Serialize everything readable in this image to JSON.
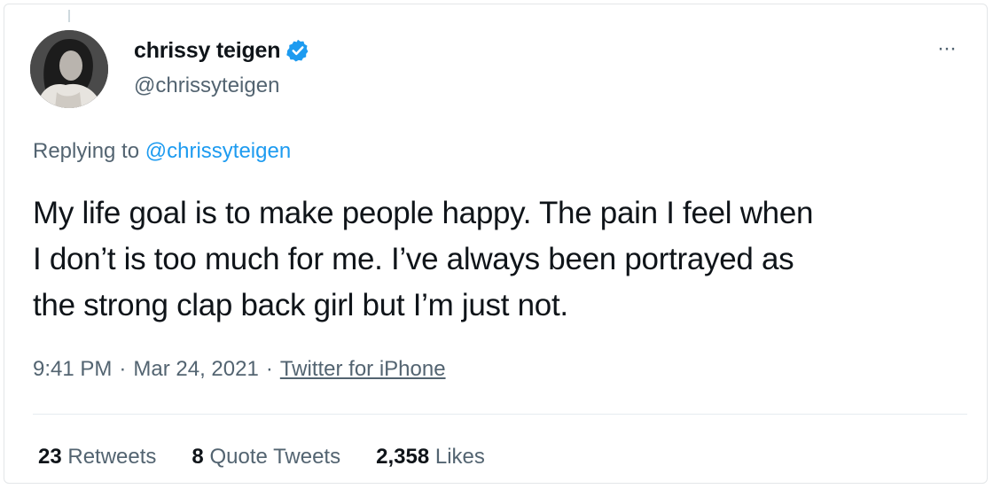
{
  "user": {
    "display_name": "chrissy teigen",
    "handle": "@chrissyteigen",
    "verified": true,
    "verified_color": "#1d9bf0"
  },
  "more_label": "···",
  "reply": {
    "prefix": "Replying to ",
    "mention": "@chrissyteigen"
  },
  "tweet": {
    "text": "My life goal is to make people happy. The pain I feel when\nI don’t is too much for me. I’ve always been portrayed as\nthe strong clap back girl but I’m just not."
  },
  "meta": {
    "time": "9:41 PM",
    "separator": "·",
    "date": "Mar 24, 2021",
    "source": "Twitter for iPhone"
  },
  "stats": {
    "retweets_count": "23",
    "retweets_label": "Retweets",
    "quotes_count": "8",
    "quotes_label": "Quote Tweets",
    "likes_count": "2,358",
    "likes_label": "Likes"
  },
  "colors": {
    "text_primary": "#0f1419",
    "text_secondary": "#536471",
    "accent": "#1d9bf0"
  }
}
